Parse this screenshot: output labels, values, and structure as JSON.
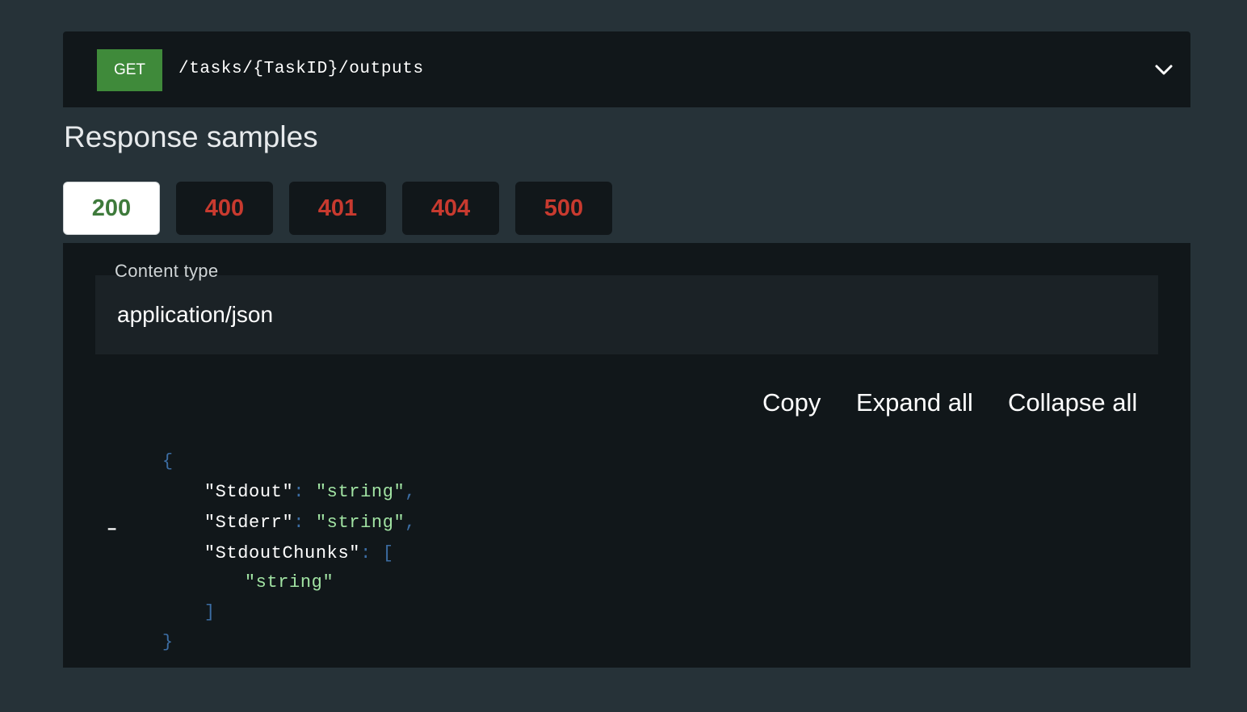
{
  "endpoint": {
    "method": "GET",
    "path": "/tasks/{TaskID}/outputs",
    "expand_icon": "chevron-down-icon"
  },
  "section_title": "Response samples",
  "tabs": [
    {
      "label": "200",
      "active": true,
      "color": "#3e7a3b"
    },
    {
      "label": "400",
      "active": false,
      "color": "#c83a2f"
    },
    {
      "label": "401",
      "active": false,
      "color": "#c83a2f"
    },
    {
      "label": "404",
      "active": false,
      "color": "#c83a2f"
    },
    {
      "label": "500",
      "active": false,
      "color": "#c83a2f"
    }
  ],
  "content_type": {
    "label": "Content type",
    "value": "application/json"
  },
  "actions": {
    "copy": "Copy",
    "expand_all": "Expand all",
    "collapse_all": "Collapse all"
  },
  "json_sample": {
    "open_brace": "{",
    "close_brace": "}",
    "open_bracket": "[",
    "close_bracket": "]",
    "colon": ":",
    "comma": ",",
    "collapse_toggle": "–",
    "fields": [
      {
        "key": "\"Stdout\"",
        "value": "\"string\""
      },
      {
        "key": "\"Stderr\"",
        "value": "\"string\""
      },
      {
        "key": "\"StdoutChunks\"",
        "items": [
          "\"string\""
        ]
      }
    ]
  },
  "colors": {
    "background": "#263238",
    "panel": "#11171a",
    "method_get": "#3f8a3a",
    "success": "#3e7a3b",
    "error": "#c83a2f",
    "json_string": "#a1e3a3",
    "json_punctuation": "#3c6da3"
  }
}
